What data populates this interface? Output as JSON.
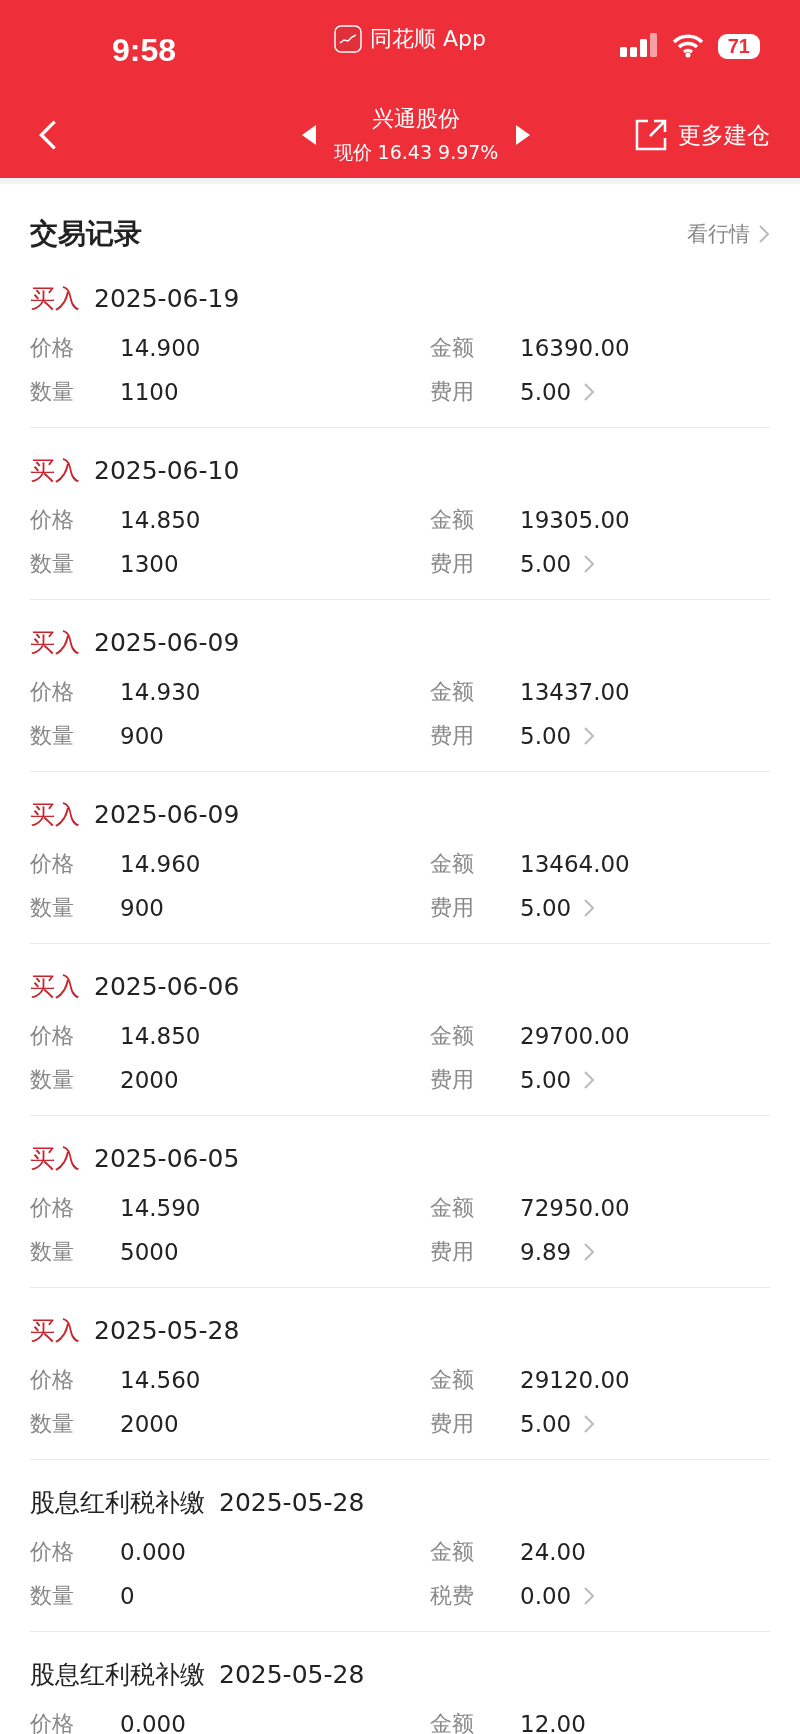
{
  "status_bar": {
    "time": "9:58",
    "app_name": "同花顺 App",
    "battery": "71"
  },
  "nav": {
    "title": "兴通股份",
    "quote": "现价 16.43 9.97%",
    "action": "更多建仓"
  },
  "section": {
    "title": "交易记录",
    "link": "看行情"
  },
  "records": [
    {
      "kind": "trade",
      "type": "买入",
      "date": "2025-06-19",
      "fields": [
        {
          "label": "价格",
          "value": "14.900"
        },
        {
          "label": "金额",
          "value": "16390.00"
        },
        {
          "label": "数量",
          "value": "1100"
        },
        {
          "label": "费用",
          "value": "5.00",
          "more": true
        }
      ]
    },
    {
      "kind": "trade",
      "type": "买入",
      "date": "2025-06-10",
      "fields": [
        {
          "label": "价格",
          "value": "14.850"
        },
        {
          "label": "金额",
          "value": "19305.00"
        },
        {
          "label": "数量",
          "value": "1300"
        },
        {
          "label": "费用",
          "value": "5.00",
          "more": true
        }
      ]
    },
    {
      "kind": "trade",
      "type": "买入",
      "date": "2025-06-09",
      "fields": [
        {
          "label": "价格",
          "value": "14.930"
        },
        {
          "label": "金额",
          "value": "13437.00"
        },
        {
          "label": "数量",
          "value": "900"
        },
        {
          "label": "费用",
          "value": "5.00",
          "more": true
        }
      ]
    },
    {
      "kind": "trade",
      "type": "买入",
      "date": "2025-06-09",
      "fields": [
        {
          "label": "价格",
          "value": "14.960"
        },
        {
          "label": "金额",
          "value": "13464.00"
        },
        {
          "label": "数量",
          "value": "900"
        },
        {
          "label": "费用",
          "value": "5.00",
          "more": true
        }
      ]
    },
    {
      "kind": "trade",
      "type": "买入",
      "date": "2025-06-06",
      "fields": [
        {
          "label": "价格",
          "value": "14.850"
        },
        {
          "label": "金额",
          "value": "29700.00"
        },
        {
          "label": "数量",
          "value": "2000"
        },
        {
          "label": "费用",
          "value": "5.00",
          "more": true
        }
      ]
    },
    {
      "kind": "trade",
      "type": "买入",
      "date": "2025-06-05",
      "fields": [
        {
          "label": "价格",
          "value": "14.590"
        },
        {
          "label": "金额",
          "value": "72950.00"
        },
        {
          "label": "数量",
          "value": "5000"
        },
        {
          "label": "费用",
          "value": "9.89",
          "more": true
        }
      ]
    },
    {
      "kind": "trade",
      "type": "买入",
      "date": "2025-05-28",
      "fields": [
        {
          "label": "价格",
          "value": "14.560"
        },
        {
          "label": "金额",
          "value": "29120.00"
        },
        {
          "label": "数量",
          "value": "2000"
        },
        {
          "label": "费用",
          "value": "5.00",
          "more": true
        }
      ]
    },
    {
      "kind": "dividend",
      "type": "股息红利税补缴",
      "date": "2025-05-28",
      "fields": [
        {
          "label": "价格",
          "value": "0.000"
        },
        {
          "label": "金额",
          "value": "24.00"
        },
        {
          "label": "数量",
          "value": "0"
        },
        {
          "label": "税费",
          "value": "0.00",
          "more": true
        }
      ]
    },
    {
      "kind": "dividend",
      "type": "股息红利税补缴",
      "date": "2025-05-28",
      "fields": [
        {
          "label": "价格",
          "value": "0.000"
        },
        {
          "label": "金额",
          "value": "12.00"
        }
      ]
    }
  ]
}
